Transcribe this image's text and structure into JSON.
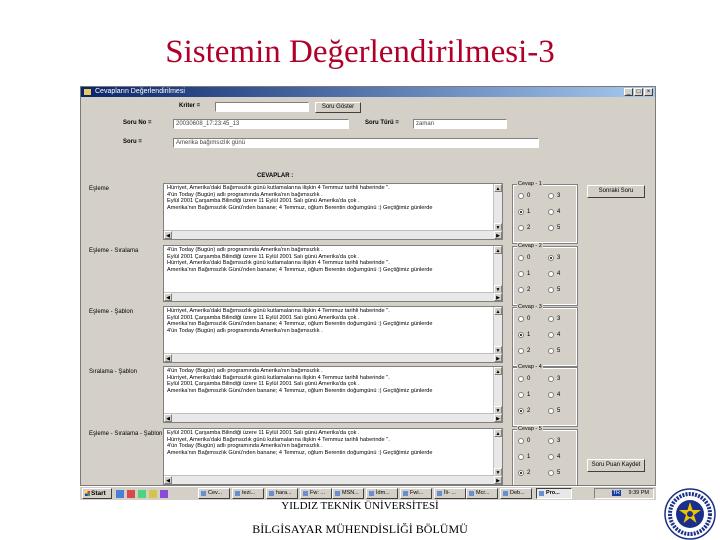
{
  "slide_title": "Sistemin Değerlendirilmesi-3",
  "window": {
    "title": "Cevapların Değerlendirilmesi",
    "controls": [
      "_",
      "□",
      "×"
    ]
  },
  "form": {
    "kriter_label": "Kriter =",
    "kriter_value": "",
    "soru_goster_button": "Soru Göster",
    "soru_no_label": "Soru No =",
    "soru_no_value": "20030608_17:23:45_13",
    "soru_turu_label": "Soru Türü =",
    "soru_turu_value": "zaman",
    "soru_label": "Soru =",
    "soru_value": "Amerika bağımsızlık günü",
    "cevaplar_label": "CEVAPLAR :",
    "sonraki_soru_button": "Sonraki Soru",
    "kaydet_button": "Soru Puan Kaydet"
  },
  "answers": [
    {
      "label": "Eşleme",
      "lines": [
        "Hürriyet, Amerika'daki Bağımsızlık günü kutlamalarına ilişkin 4 Temmuz tarihli haberinde \".",
        "4'ün Today (Bugün) adlı programında Amerika'nın bağımsızlık .",
        "Eylül 2001 Çarşamba Bilindiği üzere 11 Eylül 2001 Salı günü Amerika'da çok .",
        "Amerika'nın Bağımsızlık Günü'nden bananе; 4 Temmuz, oğlum Berentin doğumgünü :) Geçtiğimiz günlerde"
      ],
      "group_title": "Cevap - 1",
      "selected": "1"
    },
    {
      "label": "Eşleme - Sıralama",
      "lines": [
        "4'ün Today (Bugün) adlı programında Amerika'nın bağımsızlık .",
        "Eylül 2001 Çarşamba Bilindiği üzere 11 Eylül 2001 Salı günü Amerika'da çok .",
        "Hürriyet, Amerika'daki Bağımsızlık günü kutlamalarına ilişkin 4 Temmuz tarihli haberinde \".",
        "Amerika'nın Bağımsızlık Günü'nden bananе; 4 Temmuz, oğlum Berentin doğumgünü :) Geçtiğimiz günlerde"
      ],
      "group_title": "Cevap - 2",
      "selected": "3"
    },
    {
      "label": "Eşleme - Şablon",
      "lines": [
        "Hürriyet, Amerika'daki Bağımsızlık günü kutlamalarına ilişkin 4 Temmuz tarihli haberinde \".",
        "Eylül 2001 Çarşamba Bilindiği üzere 11 Eylül 2001 Salı günü Amerika'da çok .",
        "Amerika'nın Bağımsızlık Günü'nden bananе; 4 Temmuz, oğlum Berentin doğumgünü :) Geçtiğimiz günlerde",
        "4'ün Today (Bugün) adlı programında Amerika'nın bağımsızlık ."
      ],
      "group_title": "Cevap - 3",
      "selected": "1"
    },
    {
      "label": "Sıralama - Şablon",
      "lines": [
        "4'ün Today (Bugün) adlı programında Amerika'nın bağımsızlık .",
        "Hürriyet, Amerika'daki Bağımsızlık günü kutlamalarına ilişkin 4 Temmuz tarihli haberinde \".",
        "Eylül 2001 Çarşamba Bilindiği üzere 11 Eylül 2001 Salı günü Amerika'da çok .",
        "Amerika'nın Bağımsızlık Günü'nden bananе; 4 Temmuz, oğlum Berentin doğumgünü :) Geçtiğimiz günlerde"
      ],
      "group_title": "Cevap - 4",
      "selected": "2"
    },
    {
      "label": "Eşleme - Sıralama - Şablon",
      "lines": [
        "Eylül 2001 Çarşamba Bilindiği üzere 11 Eylül 2001 Salı günü Amerika'da çok .",
        "Hürriyet, Amerika'daki Bağımsızlık günü kutlamalarına ilişkin 4 Temmuz tarihli haberinde \".",
        "4'ün Today (Bugün) adlı programında Amerika'nın bağımsızlık .",
        "Amerika'nın Bağımsızlık Günü'nden bananе; 4 Temmuz, oğlum Berentin doğumgünü :) Geçtiğimiz günlerde"
      ],
      "group_title": "Cevap - 5",
      "selected": "2"
    }
  ],
  "radio_options": [
    "0",
    "3",
    "1",
    "4",
    "2",
    "5"
  ],
  "taskbar": {
    "start_label": "Start",
    "tasks": [
      "Cev...",
      "tezi...",
      "hara...",
      "Fw: ...",
      "MSN...",
      "İdm...",
      "Fwi...",
      "İli- ...",
      "Mcr...",
      "Deb...",
      "Pro..."
    ],
    "active_task_index": 10,
    "tray_text": "TR",
    "clock": "9:39 PM"
  },
  "footer": {
    "line1": "YILDIZ TEKNİK ÜNİVERSİTESİ",
    "line2": "BİLGİSAYAR MÜHENDİSLİĞİ BÖLÜMÜ"
  },
  "colors": {
    "title": "#b0002a",
    "window_bg": "#d4d0c8",
    "titlebar": "#0a246a"
  }
}
